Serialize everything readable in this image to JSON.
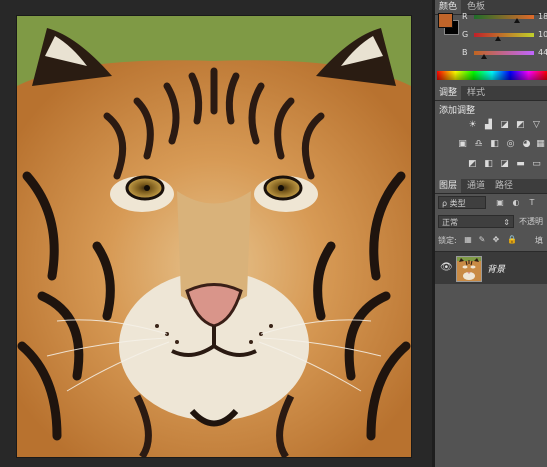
{
  "panels": {
    "top_tabs": [
      "颜色",
      "色板"
    ],
    "color": {
      "foreground": "#c0652a",
      "background": "#000000",
      "sliders": [
        {
          "label": "R",
          "value": "18",
          "from": "#1f6d2a",
          "to": "#e06a2a",
          "fraction": 0.72
        },
        {
          "label": "G",
          "value": "10",
          "from": "#c0202a",
          "to": "#c0d02a",
          "fraction": 0.4
        },
        {
          "label": "B",
          "value": "44",
          "from": "#c06520",
          "to": "#c065ff",
          "fraction": 0.17
        }
      ]
    },
    "adjust_tabs": [
      "调整",
      "样式"
    ],
    "adjust_title": "添加调整",
    "adjust_icons_row1": [
      "☀",
      "▟",
      "◪",
      "◩",
      "▽"
    ],
    "adjust_icons_row2": [
      "▣",
      "♎",
      "◧",
      "◎",
      "◕",
      "▦"
    ],
    "adjust_icons_row3": [
      "◩",
      "◧",
      "◪",
      "▬",
      "▭"
    ],
    "layers_tabs": [
      "图层",
      "通道",
      "路径"
    ],
    "filter_label": "ρ 类型",
    "filter_icons": [
      "▣",
      "◐",
      "T"
    ],
    "blend_mode": "正常",
    "opacity_label": "不透明",
    "lock_label": "锁定:",
    "lock_icons": [
      "▦",
      "✎",
      "✥",
      "🔒"
    ],
    "fill_label": "填",
    "layer": {
      "name": "背景"
    }
  }
}
